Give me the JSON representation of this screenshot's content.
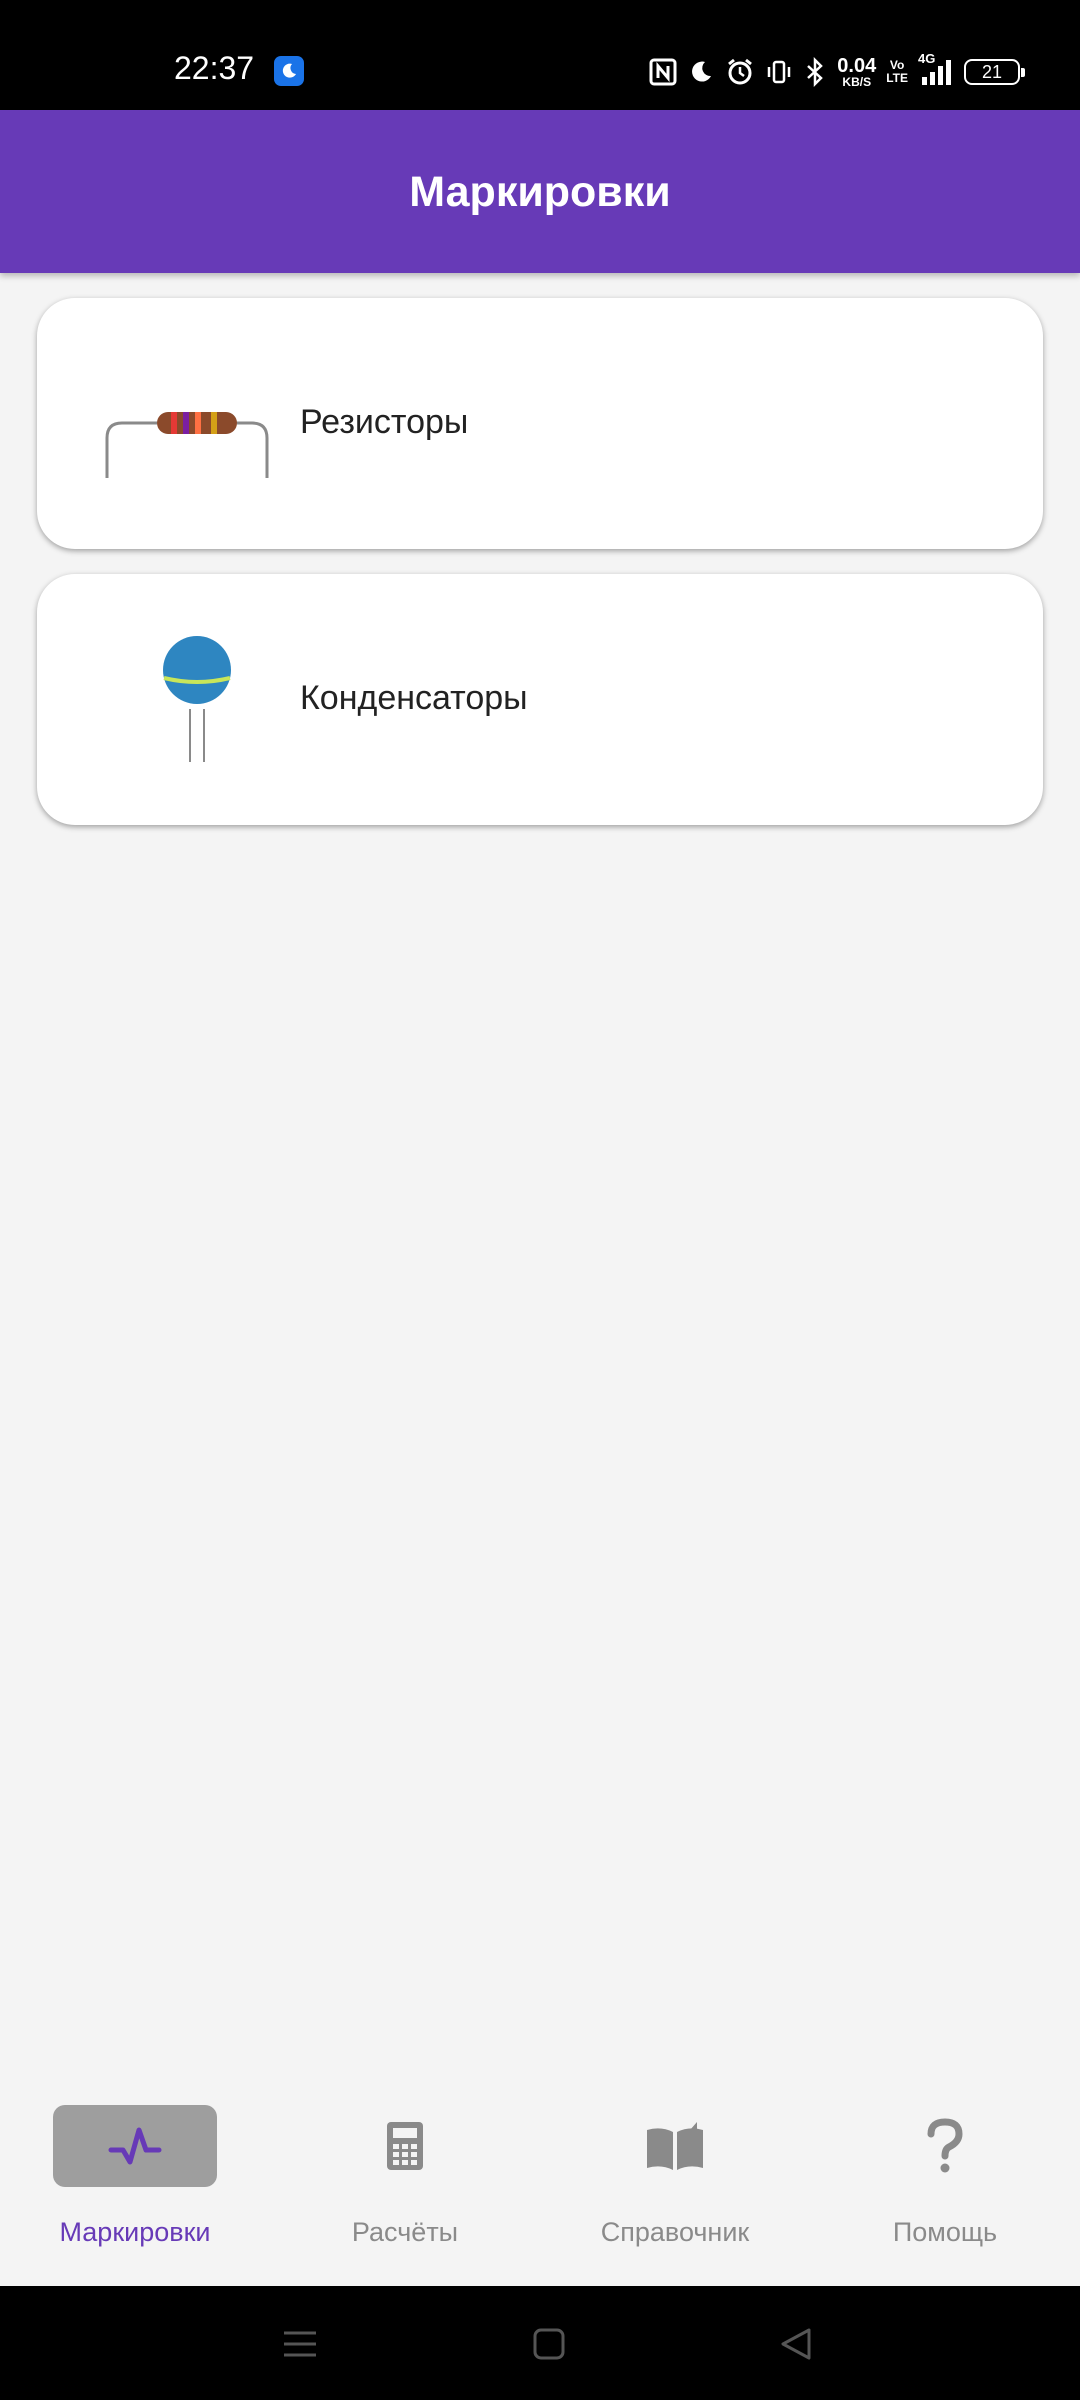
{
  "status_bar": {
    "time": "22:37",
    "net_speed_value": "0.04",
    "net_speed_unit": "KB/S",
    "volte_top": "Vo",
    "volte_bottom": "LTE",
    "network": "4G",
    "battery": "21"
  },
  "app_bar": {
    "title": "Маркировки"
  },
  "cards": [
    {
      "label": "Резисторы",
      "icon": "resistor-icon"
    },
    {
      "label": "Конденсаторы",
      "icon": "capacitor-icon"
    }
  ],
  "bottom_nav": {
    "active_index": 0,
    "accent_color": "#673ab7",
    "items": [
      {
        "label": "Маркировки",
        "icon": "pulse-icon"
      },
      {
        "label": "Расчёты",
        "icon": "calculator-icon"
      },
      {
        "label": "Справочник",
        "icon": "book-icon"
      },
      {
        "label": "Помощь",
        "icon": "help-icon"
      }
    ]
  }
}
